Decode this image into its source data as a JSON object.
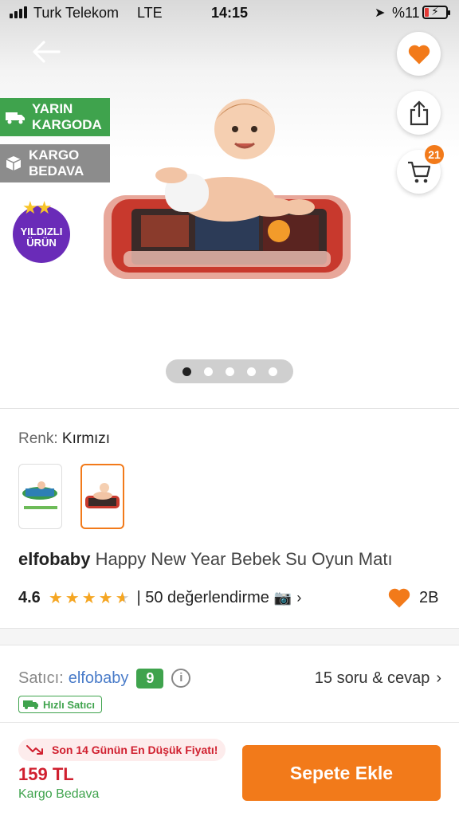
{
  "status_bar": {
    "carrier": "Turk Telekom",
    "network": "LTE",
    "time": "14:15",
    "battery": "%11"
  },
  "hero": {
    "badges": {
      "fast_delivery": "YARIN KARGODA",
      "free_shipping": "KARGO BEDAVA",
      "star_product": "YILDIZLI ÜRÜN"
    },
    "cart_count": "21",
    "image_count": 5,
    "active_image": 0
  },
  "variant": {
    "label": "Renk:",
    "value": "Kırmızı"
  },
  "product": {
    "brand": "elfobaby",
    "name": "Happy New Year Bebek Su Oyun Matı",
    "rating": "4.6",
    "reviews": "| 50 değerlendirme",
    "likes": "2B"
  },
  "seller": {
    "label": "Satıcı:",
    "name": "elfobaby",
    "score": "9",
    "qa": "15 soru & cevap",
    "fast_seller": "Hızlı Satıcı"
  },
  "bottom_bar": {
    "lowest_price": "Son 14 Günün En Düşük Fiyatı!",
    "price": "159 TL",
    "shipping": "Kargo Bedava",
    "add_to_cart": "Sepete Ekle"
  },
  "colors": {
    "accent": "#f27a1a",
    "green": "#3fa34d",
    "price_red": "#d0202f"
  }
}
